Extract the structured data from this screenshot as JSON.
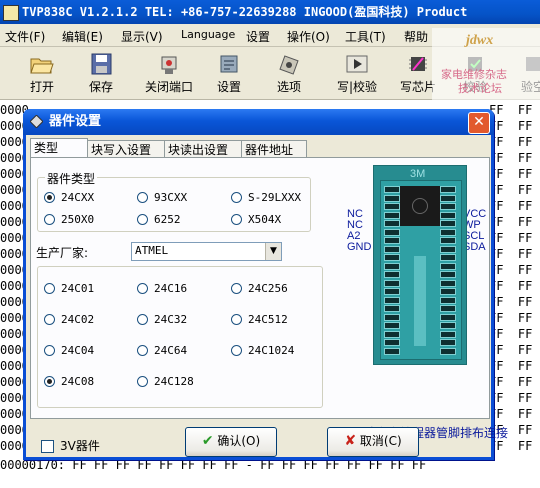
{
  "app": {
    "title": "TVP838C  V1.2.1.2  TEL: +86-757-22639288  INGOOD(盈国科技) Product"
  },
  "menu": [
    "文件(F)",
    "编辑(E)",
    "显示(V)",
    "Language",
    "设置",
    "操作(O)",
    "工具(T)",
    "帮助"
  ],
  "toolbar": [
    "打开",
    "保存",
    "关闭端口",
    "设置",
    "选项",
    "写|校验",
    "写芯片",
    "校验",
    "验空"
  ],
  "watermark": {
    "logo": "jdwx",
    "line1": "家电维修杂志",
    "line2": "技术论坛"
  },
  "hex": {
    "prefix": "0000",
    "right_values": "FF  FF",
    "bottom_line": "00000170: FF FF FF FF FF FF FF FF - FF FF FF FF FF FF FF FF"
  },
  "dialog": {
    "title": "器件设置",
    "close": "✕",
    "tabs": [
      "类型",
      "块写入设置",
      "块读出设置",
      "器件地址"
    ],
    "device_type_label": "器件类型",
    "device_types": [
      "24CXX",
      "93CXX",
      "S-29LXXX",
      "250X0",
      "6252",
      "X504X"
    ],
    "selected_type": "24CXX",
    "manufacturer_label": "生产厂家:",
    "manufacturer": "ATMEL",
    "models": [
      "24C01",
      "24C16",
      "24C256",
      "24C02",
      "24C32",
      "24C512",
      "24C04",
      "24C64",
      "24C1024",
      "24C08",
      "24C128"
    ],
    "selected_model": "24C08",
    "chip_label": "3M",
    "pins_left": [
      "NC",
      "NC",
      "A2",
      "GND"
    ],
    "pins_right": [
      "VCC",
      "WP",
      "SCL",
      "SDA"
    ],
    "note": "请参考编程器管脚排布连接",
    "option_3v": "3V器件",
    "option_3v_checked": false,
    "ok_label": "确认(O)",
    "cancel_label": "取消(C)"
  },
  "colors": {
    "title_blue": "#0a56d8",
    "chip_teal": "#278c90",
    "pin_label_blue": "#0b1a9c",
    "close_red": "#e2592d"
  }
}
